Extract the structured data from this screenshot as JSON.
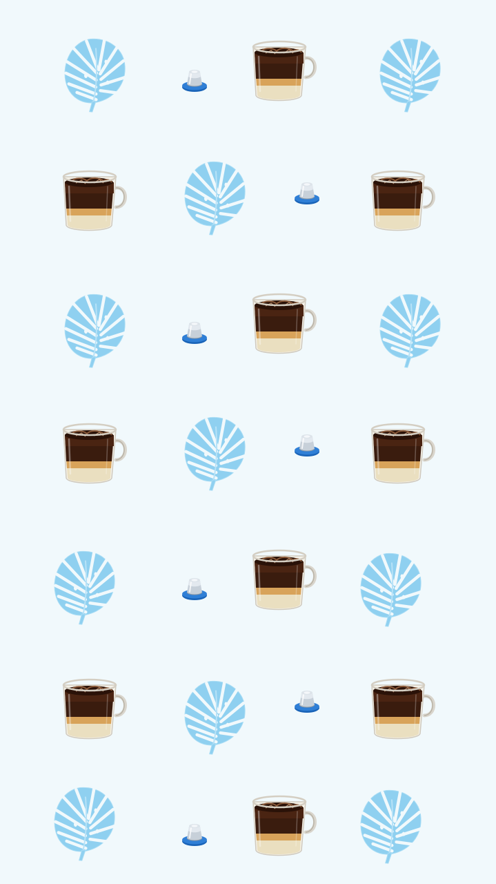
{
  "wallpaper": {
    "background_color": "#f1f9fc",
    "pattern": [
      [
        "monstera-leaf-icon",
        "coffee-capsule-icon",
        "iced-coffee-cup-icon",
        "monstera-leaf-icon"
      ],
      [
        "iced-coffee-cup-icon",
        "monstera-leaf-icon",
        "coffee-capsule-icon",
        "iced-coffee-cup-icon"
      ],
      [
        "monstera-leaf-icon",
        "coffee-capsule-icon",
        "iced-coffee-cup-icon",
        "monstera-leaf-icon"
      ],
      [
        "iced-coffee-cup-icon",
        "monstera-leaf-icon",
        "coffee-capsule-icon",
        "iced-coffee-cup-icon"
      ],
      [
        "monstera-leaf-icon",
        "coffee-capsule-icon",
        "iced-coffee-cup-icon",
        "monstera-leaf-icon"
      ],
      [
        "iced-coffee-cup-icon",
        "monstera-leaf-icon",
        "coffee-capsule-icon",
        "iced-coffee-cup-icon"
      ],
      [
        "monstera-leaf-icon",
        "coffee-capsule-icon",
        "iced-coffee-cup-icon",
        "monstera-leaf-icon"
      ]
    ],
    "colors": {
      "leaf": "#8fd0f0",
      "capsule_base": "#1f6fc6",
      "capsule_cap": "#c9d3dc",
      "coffee": "#3a1c0e",
      "coffee_light": "#d8a35a",
      "glass": "#d7d4cc"
    }
  }
}
